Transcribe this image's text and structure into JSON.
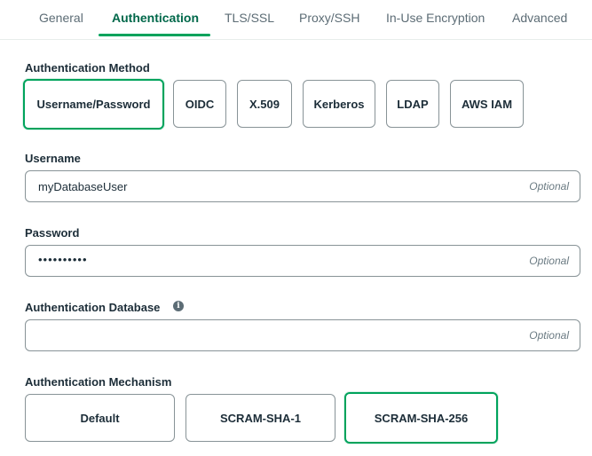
{
  "tabs": [
    {
      "label": "General"
    },
    {
      "label": "Authentication",
      "active": true
    },
    {
      "label": "TLS/SSL"
    },
    {
      "label": "Proxy/SSH"
    },
    {
      "label": "In-Use Encryption"
    },
    {
      "label": "Advanced"
    }
  ],
  "auth_method": {
    "label": "Authentication Method",
    "options": [
      "Username/Password",
      "OIDC",
      "X.509",
      "Kerberos",
      "LDAP",
      "AWS IAM"
    ],
    "selected": "Username/Password"
  },
  "username": {
    "label": "Username",
    "value": "myDatabaseUser",
    "optional": "Optional"
  },
  "password": {
    "label": "Password",
    "value": "••••••••••",
    "optional": "Optional"
  },
  "auth_database": {
    "label": "Authentication Database",
    "value": "",
    "optional": "Optional",
    "info_icon": "info-icon"
  },
  "auth_mechanism": {
    "label": "Authentication Mechanism",
    "options": [
      "Default",
      "SCRAM-SHA-1",
      "SCRAM-SHA-256"
    ],
    "selected": "SCRAM-SHA-256"
  },
  "colors": {
    "accent": "#00a35c",
    "active_tab": "#00684a",
    "border": "#889397"
  }
}
